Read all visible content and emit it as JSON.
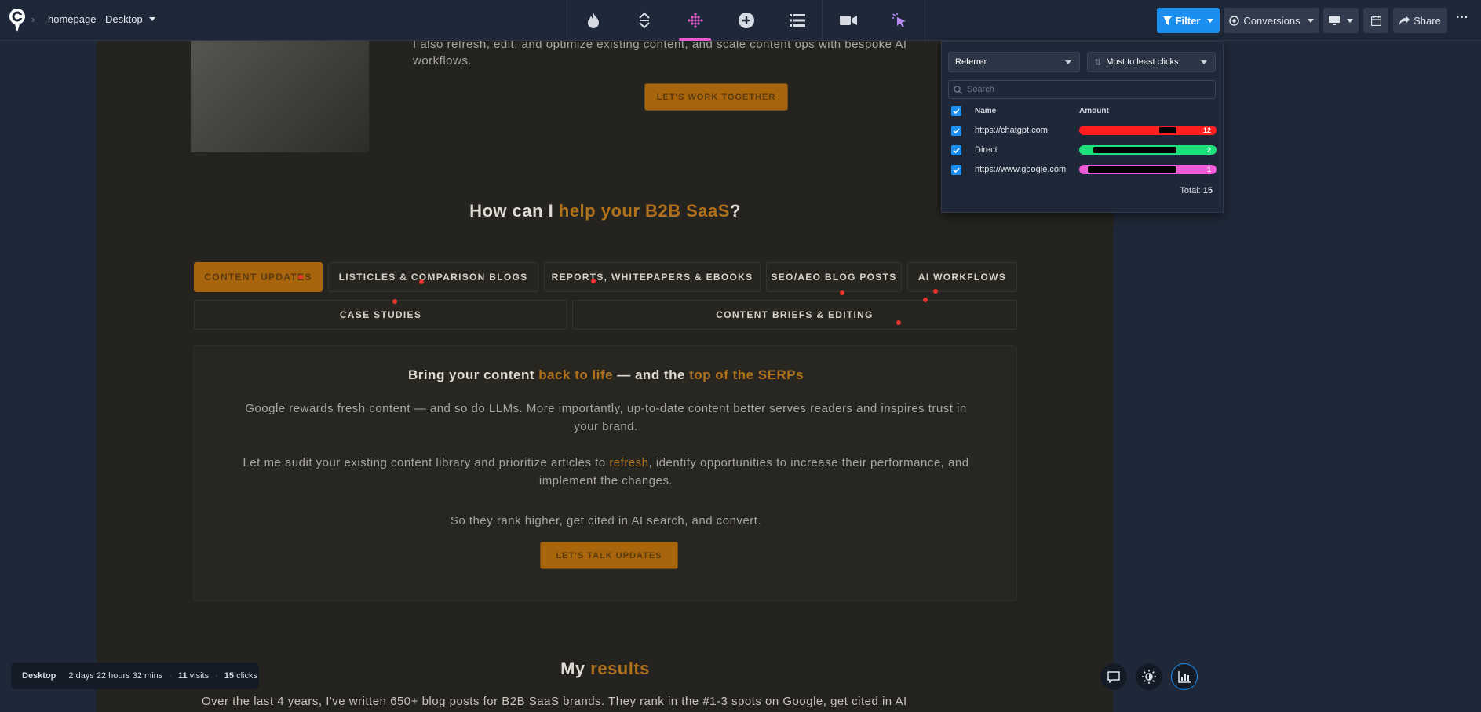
{
  "topbar": {
    "breadcrumb": "homepage - Desktop",
    "filter_label": "Filter",
    "conversions_label": "Conversions",
    "share_label": "Share",
    "more_label": "···"
  },
  "filter_panel": {
    "group_by": "Referrer",
    "sort": "Most to least clicks",
    "search_placeholder": "Search",
    "col_name": "Name",
    "col_amount": "Amount",
    "rows": [
      {
        "name": "https://chatgpt.com",
        "value": "12",
        "color": "#ff1f1f"
      },
      {
        "name": "Direct",
        "value": "2",
        "color": "#1fe07a"
      },
      {
        "name": "https://www.google.com",
        "value": "1",
        "color": "#f05ad8"
      }
    ],
    "total_label": "Total:",
    "total_value": "15"
  },
  "page": {
    "intro_line1": "I also refresh, edit, and optimize existing content, and scale content ops with bespoke AI",
    "intro_line2": "workflows.",
    "cta_work": "LET'S WORK TOGETHER",
    "help_a": "How can I ",
    "help_b": "help your B2B SaaS",
    "help_c": "?",
    "tabs": [
      "CONTENT UPDATES",
      "LISTICLES & COMPARISON BLOGS",
      "REPORTS, WHITEPAPERS & EBOOKS",
      "SEO/AEO BLOG POSTS",
      "AI WORKFLOWS",
      "CASE STUDIES",
      "CONTENT BRIEFS & EDITING"
    ],
    "card_title_a": "Bring your content ",
    "card_title_b": "back to life",
    "card_title_c": " — and the ",
    "card_title_d": "top of the SERPs",
    "para1": "Google rewards fresh content — and so do LLMs. More importantly, up-to-date content better serves readers and inspires trust in your brand.",
    "para2_a": "Let me audit your existing content library and prioritize articles to ",
    "para2_b": "refresh",
    "para2_c": ", identify opportunities to increase their performance, and implement the changes.",
    "para3": "So they rank higher, get cited in AI search, and convert.",
    "cta_talk": "LET'S TALK UPDATES",
    "results_a": "My ",
    "results_b": "results",
    "results_text": "Over the last 4 years, I've written 650+ blog posts for B2B SaaS brands. They rank in the #1-3 spots on Google, get cited in AI"
  },
  "status": {
    "device": "Desktop",
    "duration": "2 days 22 hours 32 mins",
    "sep": "·",
    "visits_n": "11",
    "visits_l": "visits",
    "clicks_n": "15",
    "clicks_l": "clicks"
  }
}
